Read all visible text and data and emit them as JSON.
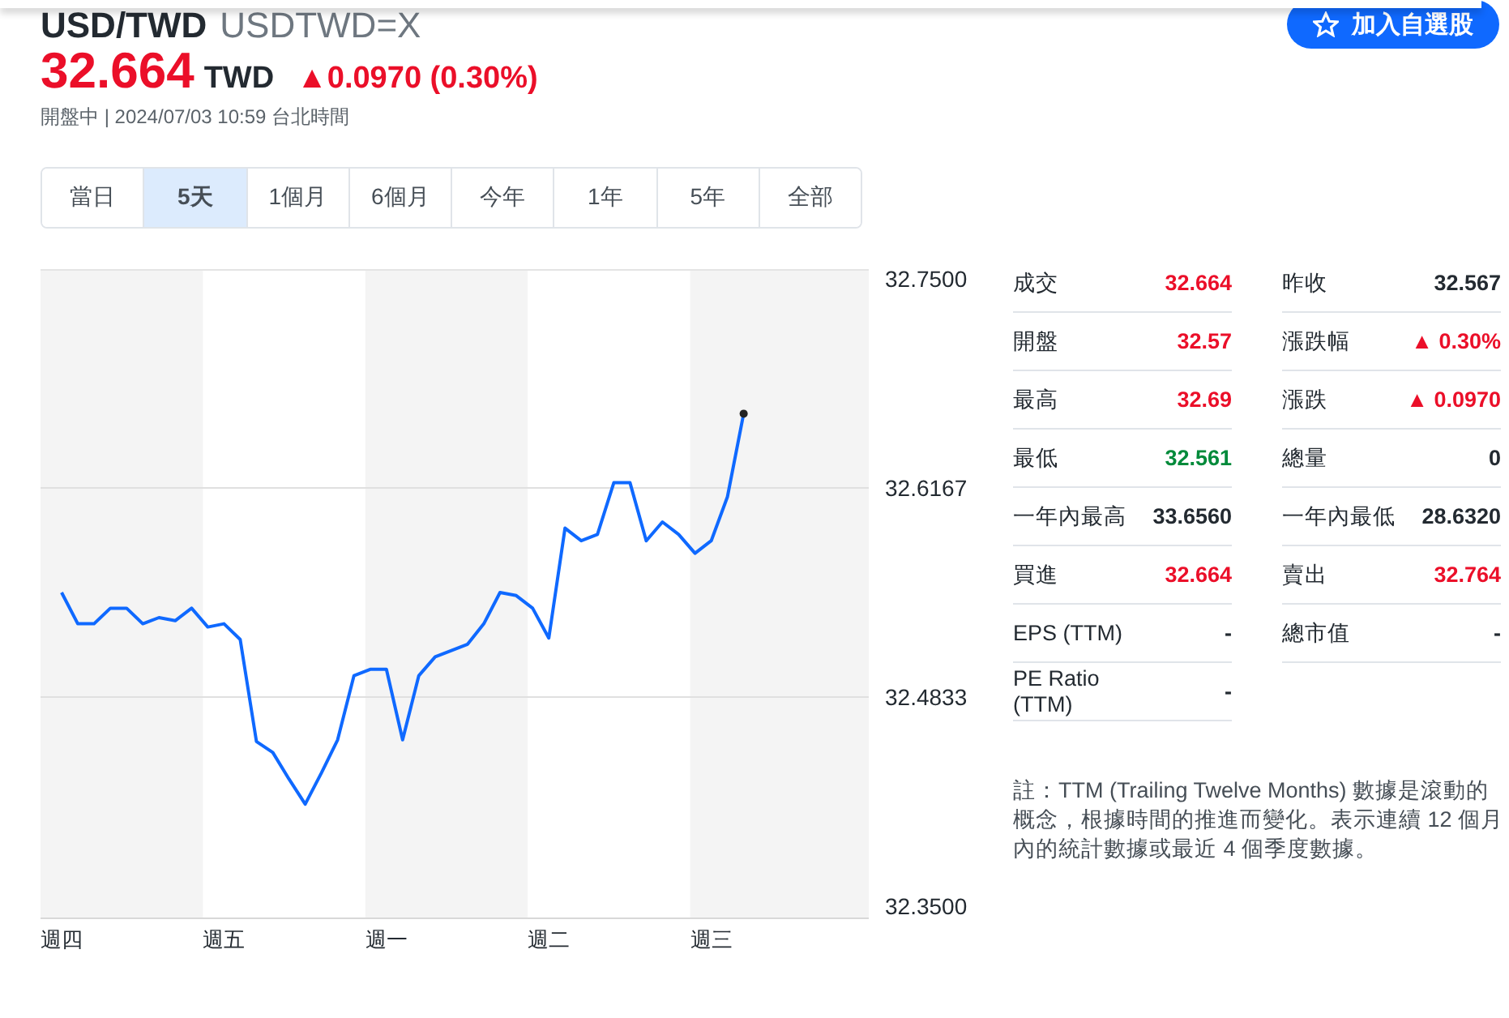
{
  "header": {
    "title": "USD/TWD",
    "symbol": "USDTWD=X",
    "watch_button": "加入自選股"
  },
  "quote": {
    "price": "32.664",
    "currency": "TWD",
    "change": "▲0.0970 (0.30%)",
    "color": "#eb0f29",
    "status": "開盤中 | 2024/07/03 10:59 台北時間"
  },
  "range_tabs": [
    {
      "label": "當日",
      "selected": false
    },
    {
      "label": "5天",
      "selected": true
    },
    {
      "label": "1個月",
      "selected": false
    },
    {
      "label": "6個月",
      "selected": false
    },
    {
      "label": "今年",
      "selected": false
    },
    {
      "label": "1年",
      "selected": false
    },
    {
      "label": "5年",
      "selected": false
    },
    {
      "label": "全部",
      "selected": false
    }
  ],
  "chart": {
    "chart_data": {
      "type": "line",
      "categories": [
        "週四",
        null,
        null,
        null,
        null,
        null,
        null,
        null,
        null,
        null,
        "週五",
        null,
        null,
        null,
        null,
        null,
        null,
        null,
        null,
        null,
        "週一",
        null,
        null,
        null,
        null,
        null,
        null,
        null,
        null,
        null,
        "週二",
        null,
        null,
        null,
        null,
        null,
        null,
        null,
        null,
        null,
        "週三",
        null,
        null,
        null,
        null,
        null,
        null,
        null,
        null,
        null,
        null
      ],
      "series": [
        {
          "color": "#0f69ff",
          "values": [
            32.55,
            32.53,
            32.53,
            32.54,
            32.54,
            32.53,
            32.534,
            32.532,
            32.54,
            32.528,
            32.53,
            32.52,
            32.455,
            32.448,
            32.431,
            32.415,
            32.435,
            32.456,
            32.497,
            32.501,
            32.501,
            32.456,
            32.497,
            32.509,
            32.513,
            32.517,
            32.53,
            32.55,
            32.548,
            32.54,
            32.521,
            32.591,
            32.583,
            32.587,
            32.62,
            32.62,
            32.583,
            32.595,
            32.587,
            32.575,
            32.583,
            32.611,
            32.664,
            null,
            null,
            null,
            null,
            null,
            null,
            null,
            null
          ]
        }
      ],
      "ylim": [
        32.35,
        32.75
      ],
      "yticks": [
        {
          "value": 32.75,
          "label": "32.7500"
        },
        {
          "value": 32.6167,
          "label": "32.6167"
        },
        {
          "value": 32.4833,
          "label": "32.4833"
        },
        {
          "value": 32.35,
          "label": "32.3500"
        }
      ]
    }
  },
  "stats": [
    [
      {
        "label": "成交",
        "value": "32.664",
        "color": "#eb0f29"
      },
      {
        "label": "昨收",
        "value": "32.567",
        "color": "#232a31"
      }
    ],
    [
      {
        "label": "開盤",
        "value": "32.57",
        "color": "#eb0f29"
      },
      {
        "label": "漲跌幅",
        "value": "▲ 0.30%",
        "color": "#eb0f29"
      }
    ],
    [
      {
        "label": "最高",
        "value": "32.69",
        "color": "#eb0f29"
      },
      {
        "label": "漲跌",
        "value": "▲ 0.0970",
        "color": "#eb0f29"
      }
    ],
    [
      {
        "label": "最低",
        "value": "32.561",
        "color": "#008a3a"
      },
      {
        "label": "總量",
        "value": "0",
        "color": "#232a31"
      }
    ],
    [
      {
        "label": "一年內最高",
        "value": "33.6560",
        "color": "#232a31"
      },
      {
        "label": "一年內最低",
        "value": "28.6320",
        "color": "#232a31"
      }
    ],
    [
      {
        "label": "買進",
        "value": "32.664",
        "color": "#eb0f29"
      },
      {
        "label": "賣出",
        "value": "32.764",
        "color": "#eb0f29"
      }
    ],
    [
      {
        "label": "EPS (TTM)",
        "value": "-",
        "color": "#232a31"
      },
      {
        "label": "總市值",
        "value": "-",
        "color": "#232a31"
      }
    ],
    [
      {
        "label": "PE Ratio (TTM)",
        "value": "-",
        "color": "#232a31"
      }
    ]
  ],
  "note": "註：TTM (Trailing Twelve Months) 數據是滾動的概念，根據時間的推進而變化。表示連續 12 個月內的統計數據或最近 4 個季度數據。"
}
